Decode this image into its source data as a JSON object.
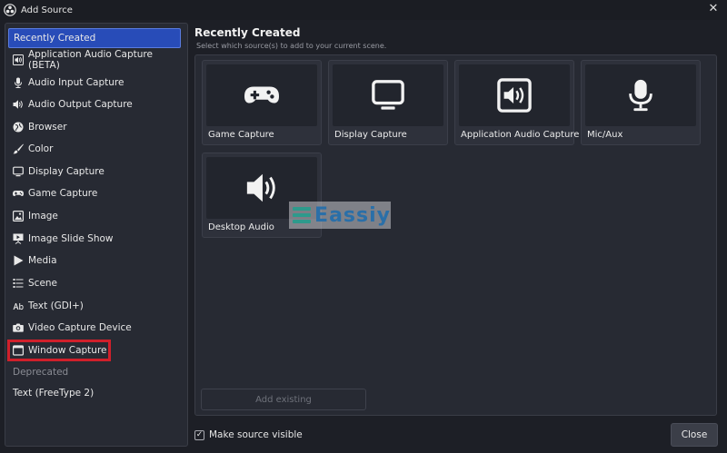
{
  "window": {
    "title": "Add Source",
    "close_icon": "close-icon"
  },
  "sidebar": {
    "items": [
      {
        "label": "Recently Created",
        "icon": "",
        "selected": true
      },
      {
        "label": "Application Audio Capture (BETA)",
        "icon": "app-audio-icon"
      },
      {
        "label": "Audio Input Capture",
        "icon": "microphone-icon"
      },
      {
        "label": "Audio Output Capture",
        "icon": "speaker-icon"
      },
      {
        "label": "Browser",
        "icon": "globe-icon"
      },
      {
        "label": "Color",
        "icon": "brush-icon"
      },
      {
        "label": "Display Capture",
        "icon": "monitor-icon"
      },
      {
        "label": "Game Capture",
        "icon": "gamepad-icon"
      },
      {
        "label": "Image",
        "icon": "image-icon"
      },
      {
        "label": "Image Slide Show",
        "icon": "slideshow-icon"
      },
      {
        "label": "Media",
        "icon": "play-icon"
      },
      {
        "label": "Scene",
        "icon": "list-icon"
      },
      {
        "label": "Text (GDI+)",
        "icon": "text-icon"
      },
      {
        "label": "Video Capture Device",
        "icon": "camera-icon"
      },
      {
        "label": "Window Capture",
        "icon": "window-icon",
        "highlighted": true
      }
    ],
    "deprecated_label": "Deprecated",
    "deprecated_items": [
      {
        "label": "Text (FreeType 2)"
      }
    ]
  },
  "main": {
    "heading": "Recently Created",
    "subheading": "Select which source(s) to add to your current scene.",
    "tiles": [
      {
        "label": "Game Capture",
        "icon": "gamepad-icon"
      },
      {
        "label": "Display Capture",
        "icon": "monitor-icon"
      },
      {
        "label": "Application Audio Capture",
        "icon": "app-audio-icon"
      },
      {
        "label": "Mic/Aux",
        "icon": "microphone-icon"
      },
      {
        "label": "Desktop Audio",
        "icon": "speaker-icon"
      }
    ],
    "add_existing_label": "Add existing"
  },
  "footer": {
    "make_visible_label": "Make source visible",
    "make_visible_checked": true,
    "close_label": "Close"
  },
  "watermark": {
    "text": "Eassiy"
  },
  "colors": {
    "selection": "#284cb8",
    "highlight_box": "#d0202b",
    "background": "#1d1f26"
  }
}
